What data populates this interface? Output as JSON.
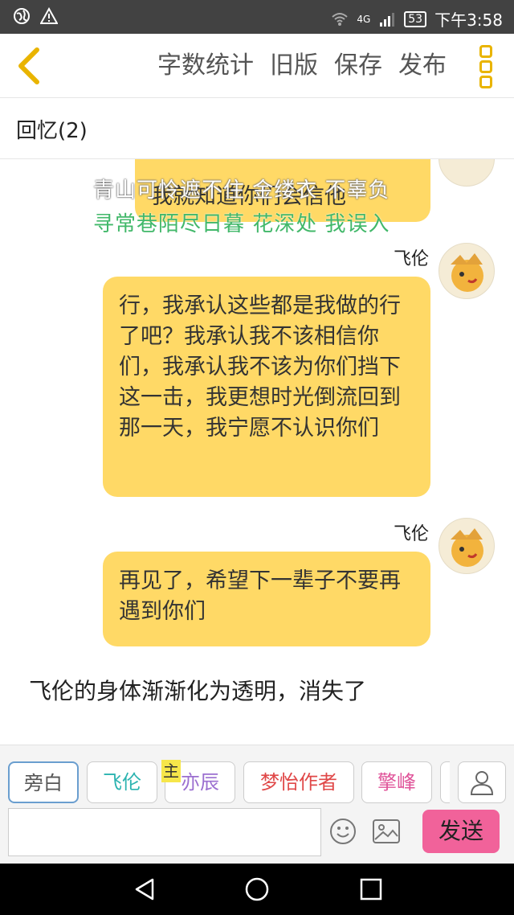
{
  "status_bar": {
    "network": "4G",
    "battery": "53",
    "time": "下午3:58"
  },
  "toolbar": {
    "word_count": "字数统计",
    "old_version": "旧版",
    "save": "保存",
    "publish": "发布"
  },
  "chapter_title": "回忆(2)",
  "subtitles": [
    "青山可怜遮不住 金缕衣 不辜负",
    "寻常巷陌尽日暮 花深处 我误入"
  ],
  "messages": [
    {
      "sender": "",
      "text": "我就知道你们会信他"
    },
    {
      "sender": "飞伦",
      "text": "行，我承认这些都是我做的行了吧？我承认我不该相信你们，我承认我不该为你们挡下这一击，我更想时光倒流回到那一天，我宁愿不认识你们"
    },
    {
      "sender": "飞伦",
      "text": "再见了，希望下一辈子不要再遇到你们"
    }
  ],
  "narration": "飞伦的身体渐渐化为透明，消失了",
  "characters": [
    {
      "name": "旁白",
      "color": "#555555"
    },
    {
      "name": "飞伦",
      "color": "#2bb3b0"
    },
    {
      "name": "亦辰",
      "color": "#9b6fd0"
    },
    {
      "name": "梦怡作者",
      "color": "#e04848"
    },
    {
      "name": "擎峰",
      "color": "#e0559a"
    }
  ],
  "main_badge": "主",
  "input": {
    "placeholder": ""
  },
  "send_label": "发送"
}
